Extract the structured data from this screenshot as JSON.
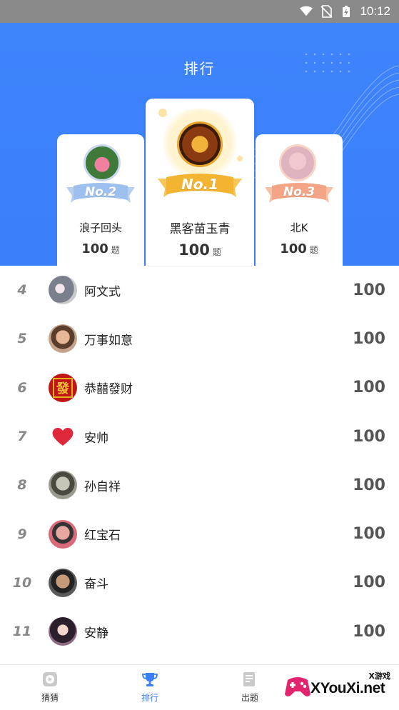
{
  "status_bar": {
    "time": "10:12",
    "icons": [
      "wifi-icon",
      "no-sim-icon",
      "battery-charging-icon"
    ]
  },
  "header": {
    "title": "排行"
  },
  "podium": {
    "first": {
      "badge": "No.1",
      "name": "黑客苗玉青",
      "score": "100",
      "unit": "题"
    },
    "second": {
      "badge": "No.2",
      "name": "浪子回头",
      "score": "100",
      "unit": "题"
    },
    "third": {
      "badge": "No.3",
      "name": "北K",
      "score": "100",
      "unit": "题"
    }
  },
  "ranking": [
    {
      "rank": "4",
      "name": "阿文式",
      "score": "100"
    },
    {
      "rank": "5",
      "name": "万事如意",
      "score": "100"
    },
    {
      "rank": "6",
      "name": "恭囍發财",
      "score": "100"
    },
    {
      "rank": "7",
      "name": "安帅",
      "score": "100"
    },
    {
      "rank": "8",
      "name": "孙自祥",
      "score": "100"
    },
    {
      "rank": "9",
      "name": "红宝石",
      "score": "100"
    },
    {
      "rank": "10",
      "name": "奋斗",
      "score": "100"
    },
    {
      "rank": "11",
      "name": "安静",
      "score": "100"
    }
  ],
  "nav": {
    "items": [
      {
        "label": "猜猜",
        "icon": "play-icon"
      },
      {
        "label": "排行",
        "icon": "trophy-icon",
        "active": true
      },
      {
        "label": "出题",
        "icon": "document-icon"
      }
    ]
  },
  "watermark": {
    "top_text": "X游戏",
    "main_text": "XYouXi.net"
  },
  "colors": {
    "primary": "#3b7ff9",
    "gold": "#f3b431",
    "silver": "#9ec0ef",
    "bronze": "#f4a585"
  }
}
